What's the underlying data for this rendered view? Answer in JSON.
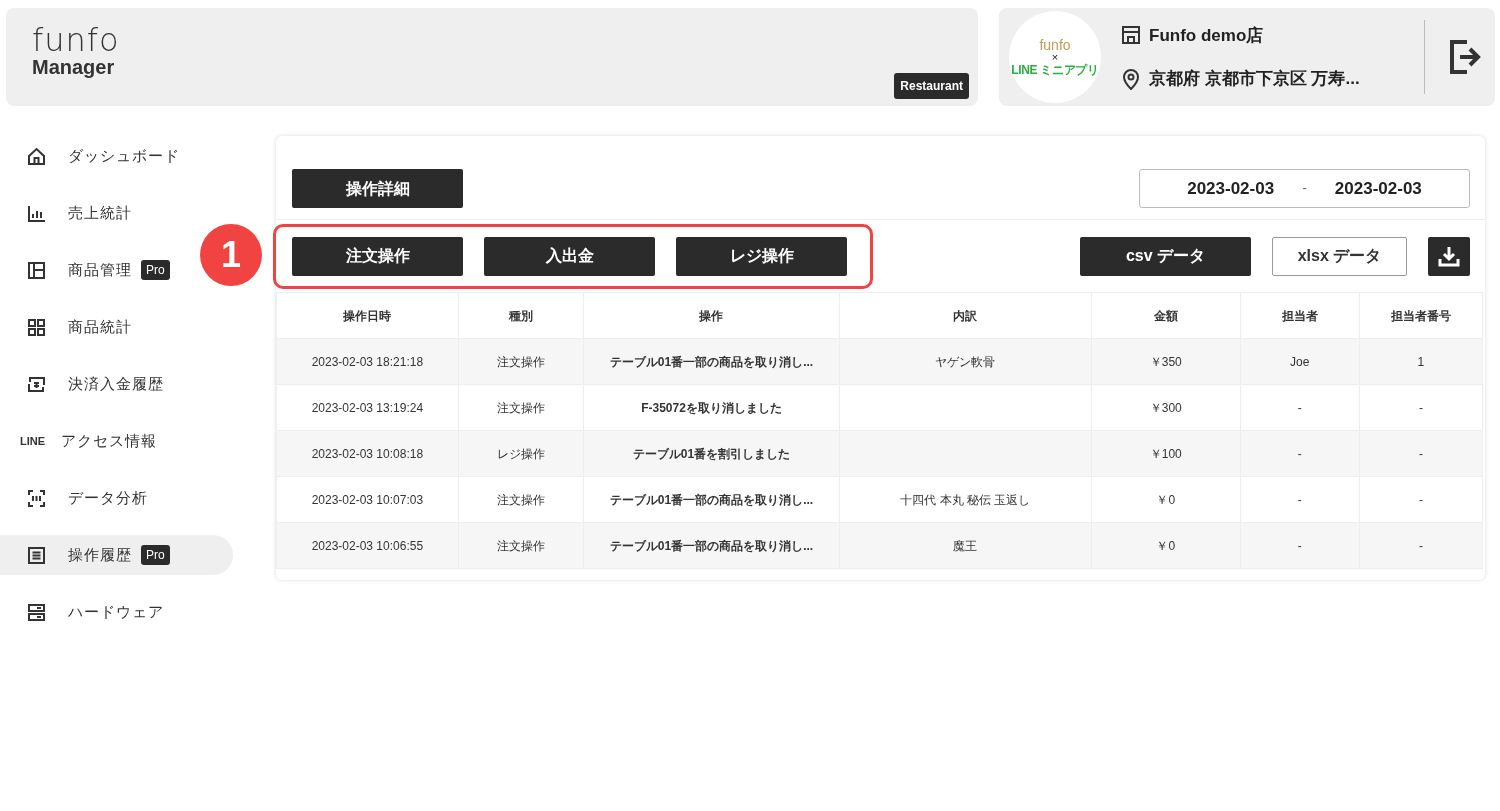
{
  "header": {
    "logo": "funfo",
    "app_name": "Manager",
    "badge": "Restaurant"
  },
  "store": {
    "logo_top": "funfo",
    "logo_mid": "×",
    "logo_bottom": "LINE ミニアプリ",
    "name": "Funfo demo店",
    "address": "京都府 京都市下京区 万寿..."
  },
  "sidebar": {
    "items": [
      {
        "kind": "home",
        "label": "ダッシュボード",
        "selected": false
      },
      {
        "kind": "bar-chart",
        "label": "売上統計",
        "selected": false
      },
      {
        "kind": "layout",
        "label": "商品管理",
        "badge": "Pro",
        "selected": false
      },
      {
        "kind": "grid",
        "label": "商品統計",
        "selected": false
      },
      {
        "kind": "exchange",
        "label": "決済入金履歴",
        "selected": false
      },
      {
        "kind": "text-logo",
        "logo_text": "LINE",
        "label": "アクセス情報",
        "selected": false
      },
      {
        "kind": "scan",
        "label": "データ分析",
        "selected": false
      },
      {
        "kind": "list",
        "label": "操作履歴",
        "badge": "Pro",
        "selected": true
      },
      {
        "kind": "hardware",
        "label": "ハードウェア",
        "selected": false
      }
    ]
  },
  "panel": {
    "title_button": "操作詳細",
    "date_from": "2023-02-03",
    "date_sep": "-",
    "date_to": "2023-02-03",
    "annotation": "1",
    "filters": [
      "注文操作",
      "入出金",
      "レジ操作"
    ],
    "exports": [
      {
        "kind": "filled",
        "label": "csv データ"
      },
      {
        "kind": "outline",
        "label": "xlsx データ"
      },
      {
        "kind": "icon"
      }
    ]
  },
  "table": {
    "columns": [
      "操作日時",
      "種別",
      "操作",
      "内訳",
      "金額",
      "担当者",
      "担当者番号"
    ],
    "rows": [
      [
        "2023-02-03 18:21:18",
        "注文操作",
        "テーブル01番一部の商品を取り消し...",
        "ヤゲン軟骨",
        "￥350",
        "Joe",
        "1"
      ],
      [
        "2023-02-03 13:19:24",
        "注文操作",
        "F-35072を取り消しました",
        "",
        "￥300",
        "-",
        "-"
      ],
      [
        "2023-02-03 10:08:18",
        "レジ操作",
        "テーブル01番を割引しました",
        "",
        "￥100",
        "-",
        "-"
      ],
      [
        "2023-02-03 10:07:03",
        "注文操作",
        "テーブル01番一部の商品を取り消し...",
        "十四代 本丸 秘伝 玉返し",
        "￥0",
        "-",
        "-"
      ],
      [
        "2023-02-03 10:06:55",
        "注文操作",
        "テーブル01番一部の商品を取り消し...",
        "魔王",
        "￥0",
        "-",
        "-"
      ]
    ]
  }
}
